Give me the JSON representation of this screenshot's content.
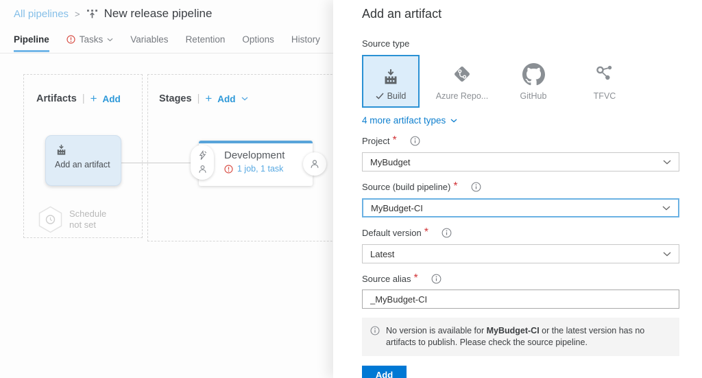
{
  "colors": {
    "accent": "#0078d4",
    "link_blue": "#1080cf",
    "canvas_link": "#2b97d8",
    "breadcrumb_link": "#85bfe8",
    "warning_red": "#d13438",
    "stage_bar": "#58a4da",
    "tile_selected_bg": "#dcedfa",
    "tile_selected_border": "#2a91d4"
  },
  "breadcrumb": {
    "link": "All pipelines",
    "separator": ">",
    "title": "New release pipeline"
  },
  "tabs": [
    {
      "label": "Pipeline"
    },
    {
      "label": "Tasks"
    },
    {
      "label": "Variables"
    },
    {
      "label": "Retention"
    },
    {
      "label": "Options"
    },
    {
      "label": "History"
    }
  ],
  "canvas": {
    "artifacts": {
      "title": "Artifacts",
      "divider": "|",
      "plus": "+",
      "add": "Add"
    },
    "artifact_card": {
      "label": "Add an artifact"
    },
    "schedule": {
      "line1": "Schedule",
      "line2": "not set"
    },
    "stages": {
      "title": "Stages",
      "divider": "|",
      "plus": "+",
      "add": "Add"
    },
    "stage": {
      "name": "Development",
      "status": "1 job, 1 task"
    }
  },
  "panel": {
    "title": "Add an artifact",
    "source_type": {
      "label": "Source type",
      "tiles": [
        {
          "label": "Build",
          "selected": true
        },
        {
          "label": "Azure Repo..."
        },
        {
          "label": "GitHub"
        },
        {
          "label": "TFVC"
        }
      ],
      "more": "4 more artifact types"
    },
    "fields": {
      "project": {
        "label": "Project",
        "required": "*",
        "value": "MyBudget"
      },
      "source": {
        "label": "Source (build pipeline)",
        "required": "*",
        "value": "MyBudget-CI"
      },
      "version": {
        "label": "Default version",
        "required": "*",
        "value": "Latest"
      },
      "alias": {
        "label": "Source alias",
        "required": "*",
        "value": "_MyBudget-CI"
      }
    },
    "notice": {
      "text1": "No version is available for ",
      "bold": "MyBudget-CI",
      "text2": " or the latest version has no artifacts to publish. Please check the source pipeline."
    },
    "add_button": "Add"
  }
}
